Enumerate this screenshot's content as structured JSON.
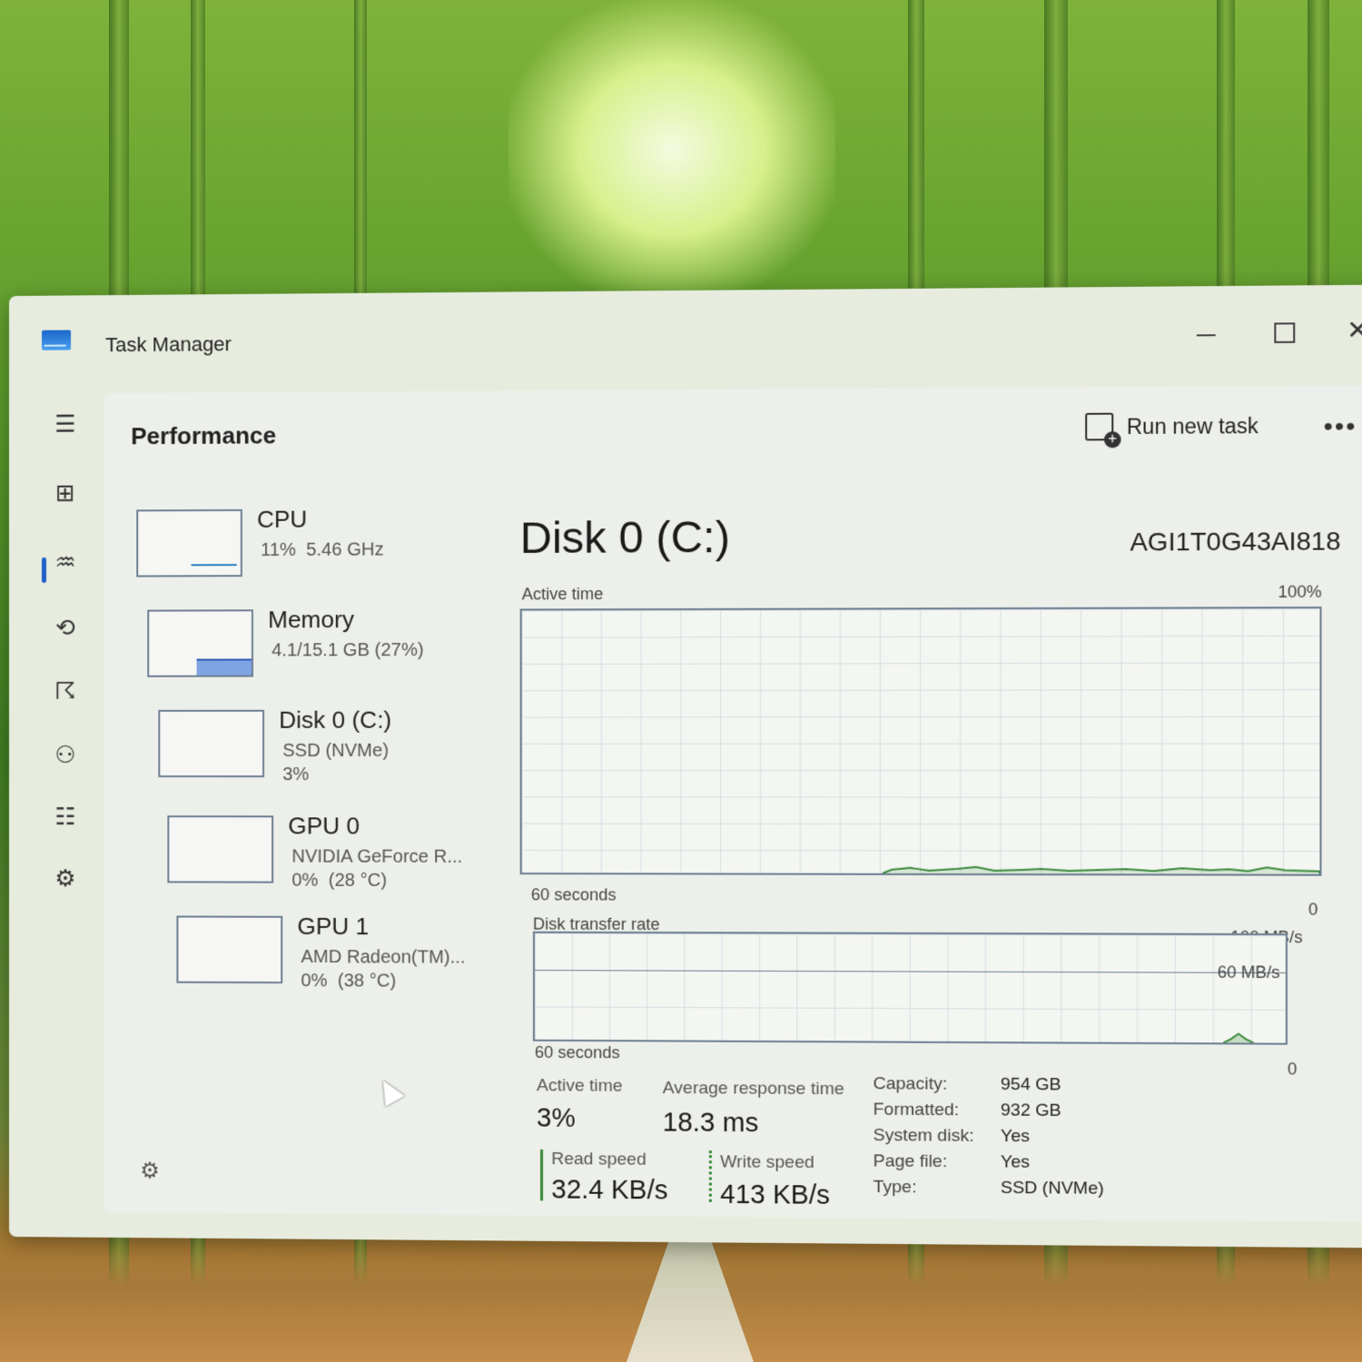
{
  "window": {
    "title": "Task Manager"
  },
  "header": {
    "title": "Performance",
    "run_task_label": "Run new task",
    "more_label": "•••"
  },
  "nav": {
    "icons": [
      "menu-icon",
      "processes-icon",
      "performance-icon",
      "app-history-icon",
      "startup-apps-icon",
      "users-icon",
      "details-icon",
      "services-icon",
      "settings-icon"
    ]
  },
  "resources": [
    {
      "name": "CPU",
      "sub": "11%  5.46 GHz"
    },
    {
      "name": "Memory",
      "sub": "4.1/15.1 GB (27%)"
    },
    {
      "name": "Disk 0 (C:)",
      "sub": "SSD (NVMe)\n3%"
    },
    {
      "name": "GPU 0",
      "sub": "NVIDIA GeForce R...\n0%  (28 °C)"
    },
    {
      "name": "GPU 1",
      "sub": "AMD Radeon(TM)...\n0%  (38 °C)"
    }
  ],
  "disk": {
    "title": "Disk 0 (C:)",
    "model": "AGI1T0G43AI818",
    "active_chart": {
      "label": "Active time",
      "max": "100%",
      "x_label": "60 seconds",
      "min": "0"
    },
    "transfer_chart": {
      "label": "Disk transfer rate",
      "max": "100 MB/s",
      "mid": "60 MB/s",
      "x_label": "60 seconds",
      "min": "0"
    },
    "stats": {
      "active_time_label": "Active time",
      "active_time_value": "3%",
      "avg_response_label": "Average response time",
      "avg_response_value": "18.3 ms",
      "read_label": "Read speed",
      "read_value": "32.4 KB/s",
      "write_label": "Write speed",
      "write_value": "413 KB/s"
    },
    "properties": [
      {
        "key": "Capacity:",
        "value": "954 GB"
      },
      {
        "key": "Formatted:",
        "value": "932 GB"
      },
      {
        "key": "System disk:",
        "value": "Yes"
      },
      {
        "key": "Page file:",
        "value": "Yes"
      },
      {
        "key": "Type:",
        "value": "SSD (NVMe)"
      }
    ]
  },
  "colors": {
    "accent": "#1d5fc9",
    "graph_line": "#3a8a3a"
  }
}
